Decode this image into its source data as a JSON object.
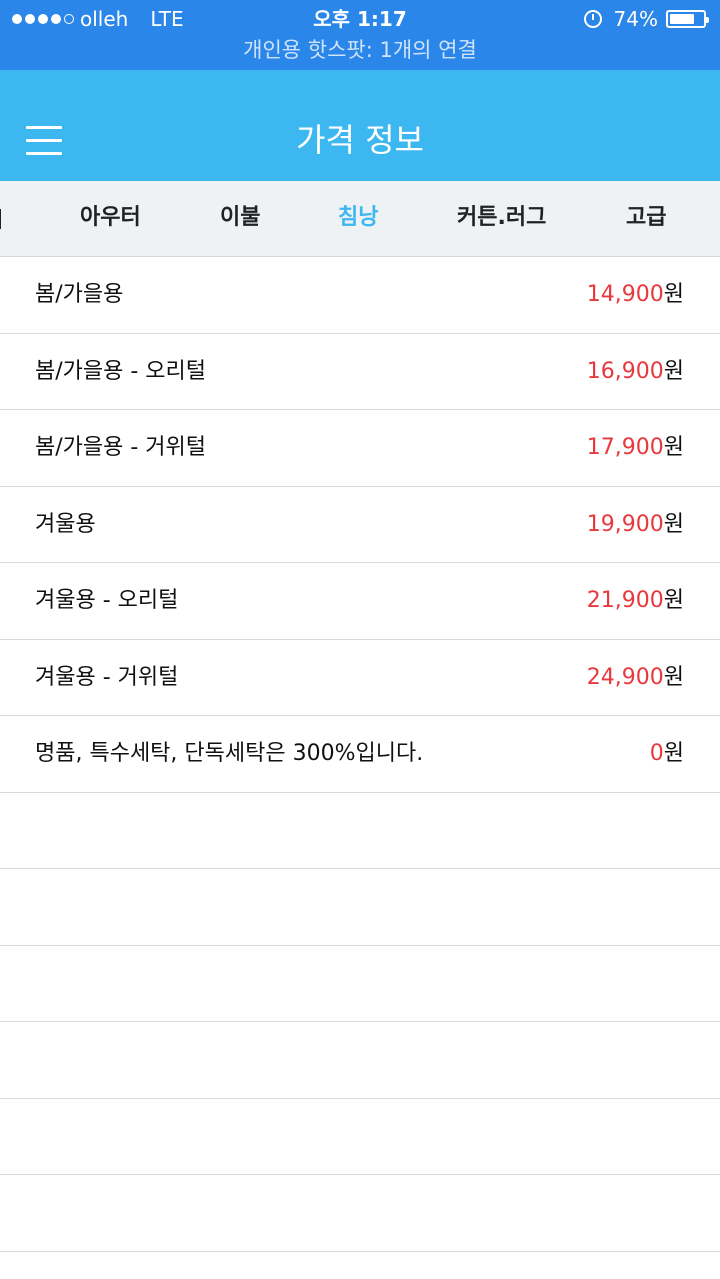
{
  "status_bar": {
    "carrier": "olleh",
    "network": "LTE",
    "time": "오후 1:17",
    "battery": "74%",
    "battery_level": 0.74,
    "signal_bars_filled": 4,
    "signal_bars_total": 5,
    "alarm_icon": "alarm-clock-icon",
    "hotspot": "개인용 핫스팟: 1개의 연결"
  },
  "header": {
    "title": "가격 정보",
    "menu_icon": "hamburger-menu-icon"
  },
  "tabs": [
    {
      "label": "아우터",
      "active": false
    },
    {
      "label": "이불",
      "active": false
    },
    {
      "label": "침낭",
      "active": true
    },
    {
      "label": "커튼.러그",
      "active": false
    },
    {
      "label": "고급",
      "active": false
    }
  ],
  "price_list": [
    {
      "name": "봄/가을용",
      "price": "14,900",
      "unit": "원"
    },
    {
      "name": "봄/가을용 - 오리털",
      "price": "16,900",
      "unit": "원"
    },
    {
      "name": "봄/가을용 - 거위털",
      "price": "17,900",
      "unit": "원"
    },
    {
      "name": "겨울용",
      "price": "19,900",
      "unit": "원"
    },
    {
      "name": "겨울용 - 오리털",
      "price": "21,900",
      "unit": "원"
    },
    {
      "name": "겨울용 - 거위털",
      "price": "24,900",
      "unit": "원"
    },
    {
      "name": "명품, 특수세탁, 단독세탁은 300%입니다.",
      "price": "0",
      "unit": "원"
    }
  ],
  "colors": {
    "status_bar": "#2a86e8",
    "nav_bar": "#3cb7f0",
    "active_tab": "#3cb7f0",
    "price": "#e8383d"
  }
}
